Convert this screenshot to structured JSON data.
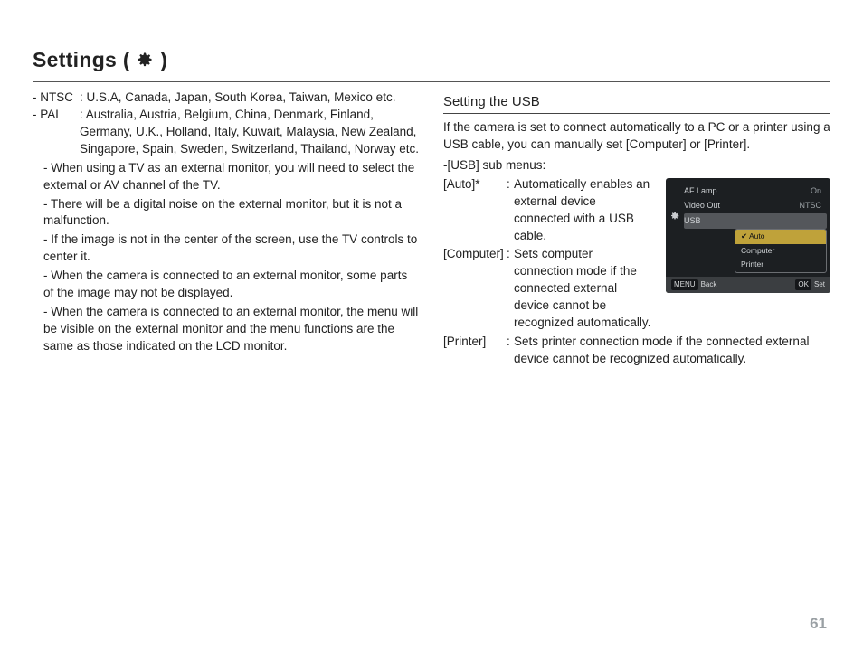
{
  "title": "Settings (",
  "title_close": ")",
  "gear_icon_name": "gear-icon",
  "left": {
    "ntsc_label": "- NTSC",
    "ntsc_desc": ": U.S.A, Canada, Japan, South Korea, Taiwan, Mexico etc.",
    "pal_label": "- PAL",
    "pal_desc": ": Australia, Austria, Belgium, China, Denmark, Finland, Germany, U.K., Holland, Italy, Kuwait, Malaysia, New Zealand, Singapore, Spain, Sweden, Switzerland, Thailand, Norway etc.",
    "bullets": [
      "- When using a TV as an external monitor, you will need to select the external or AV channel of the TV.",
      "- There will be a digital noise on the external monitor, but it is not a malfunction.",
      "- If the image is not in the center of the screen, use the TV controls to center it.",
      "- When the camera is connected to an external monitor, some parts of the image may not be displayed.",
      "- When the camera is connected to an external monitor, the menu will be visible on the external monitor and the menu functions are the same as those indicated on the LCD monitor."
    ]
  },
  "right": {
    "heading": "Setting the USB",
    "intro": "If the camera is set to connect automatically to a PC or a printer using a USB cable, you can manually set [Computer] or [Printer].",
    "submenu_label": "-[USB] sub menus:",
    "items": [
      {
        "term": "[Auto]*",
        "desc": "Automatically enables an external device connected with a USB cable."
      },
      {
        "term": "[Computer]",
        "desc": "Sets computer connection mode if the connected external device cannot be recognized automatically."
      },
      {
        "term": "[Printer]",
        "desc": "Sets printer connection mode if the connected external device cannot be recognized automatically."
      }
    ]
  },
  "cam": {
    "rows": [
      {
        "label": "AF Lamp",
        "value": "On"
      },
      {
        "label": "Video Out",
        "value": "NTSC"
      },
      {
        "label": "USB",
        "value": ""
      }
    ],
    "dropdown": [
      "Auto",
      "Computer",
      "Printer"
    ],
    "footer": {
      "left_key": "MENU",
      "left": "Back",
      "right_key": "OK",
      "right": "Set"
    }
  },
  "page_number": "61"
}
